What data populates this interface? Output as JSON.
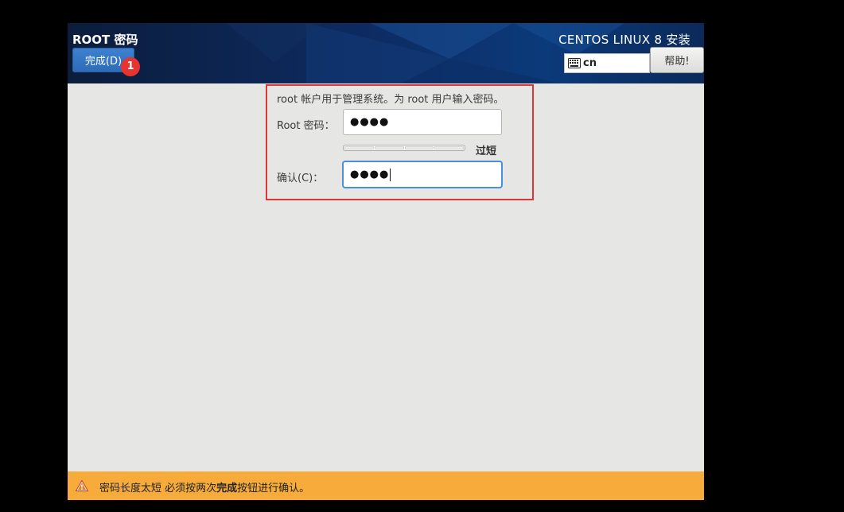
{
  "header": {
    "title": "ROOT 密码",
    "done_label": "完成(D)",
    "badge": "1",
    "product": "CENTOS LINUX 8 安装",
    "keyboard_layout": "cn",
    "help_label": "帮助!"
  },
  "form": {
    "intro": "root 帐户用于管理系统。为 root 用户输入密码。",
    "root_label": "Root 密码：",
    "root_value": "●●●●",
    "strength_label": "过短",
    "strength_level": 0,
    "confirm_label": "确认(C)：",
    "confirm_value": "●●●●"
  },
  "warning": {
    "text_before": "密码长度太短 必须按两次",
    "text_bold": "完成",
    "text_after": "按钮进行确认。"
  },
  "colors": {
    "accent": "#3578c9",
    "warning": "#f6ab3a",
    "highlight_box": "#e0333a",
    "badge": "#e8342f"
  }
}
